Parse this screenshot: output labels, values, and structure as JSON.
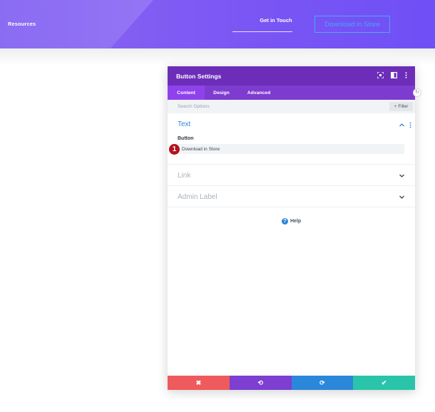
{
  "header": {
    "nav_left": "Resources",
    "nav_center": "Get in Touch",
    "cta_label": "Download in Store"
  },
  "modal": {
    "title": "Button Settings",
    "title_icons": [
      "focus-icon",
      "split-view-icon",
      "more-vertical-icon"
    ],
    "tabs": [
      {
        "label": "Content",
        "active": true
      },
      {
        "label": "Design",
        "active": false
      },
      {
        "label": "Advanced",
        "active": false
      }
    ],
    "search_placeholder": "Search Options",
    "filter_label": "Filter",
    "sections": {
      "text": {
        "title": "Text",
        "expanded": true,
        "field_label": "Button",
        "field_value": "Download in Store"
      },
      "link": {
        "title": "Link",
        "expanded": false
      },
      "admin_label": {
        "title": "Admin Label",
        "expanded": false
      }
    },
    "help_label": "Help",
    "footer_buttons": [
      {
        "name": "cancel",
        "icon": "✖",
        "color": "#ef5a5c"
      },
      {
        "name": "undo",
        "icon": "⟲",
        "color": "#7d3ed1"
      },
      {
        "name": "redo",
        "icon": "⟳",
        "color": "#2b87da"
      },
      {
        "name": "save",
        "icon": "✔",
        "color": "#29c4a9"
      }
    ]
  },
  "annotation": {
    "step_number": "1"
  },
  "colors": {
    "header_purple": "#7a55f4",
    "titlebar": "#6c2eb9",
    "tabs_bar": "#7e3bd0",
    "accent_blue": "#2b87da",
    "badge_red": "#b3121d"
  }
}
